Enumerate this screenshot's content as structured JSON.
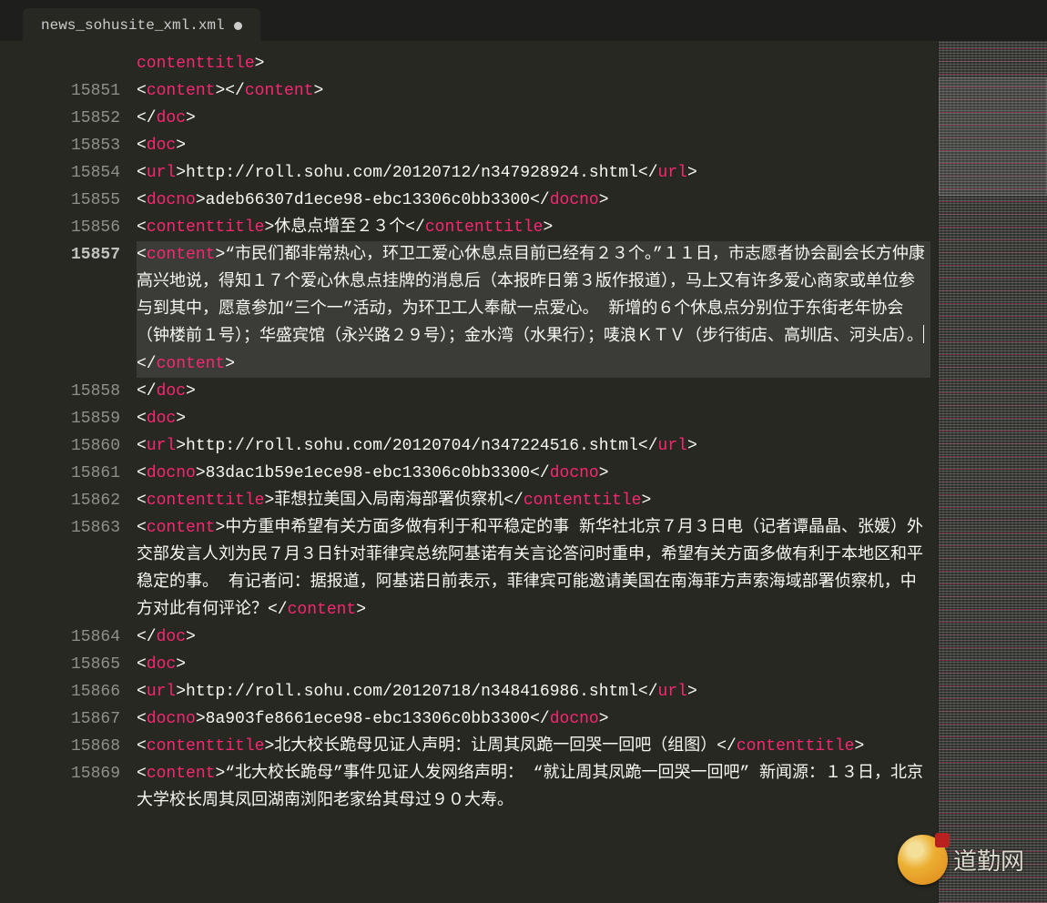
{
  "tab": {
    "filename": "news_sohusite_xml.xml",
    "dirty": true
  },
  "watermark": {
    "text": "道勤网"
  },
  "lines": [
    {
      "num": "",
      "frags": [
        [
          "tag",
          "contenttitle"
        ],
        [
          "ang",
          ">"
        ]
      ]
    },
    {
      "num": "15851",
      "frags": [
        [
          "ang",
          "<"
        ],
        [
          "tag",
          "content"
        ],
        [
          "ang",
          "></"
        ],
        [
          "tag",
          "content"
        ],
        [
          "ang",
          ">"
        ]
      ]
    },
    {
      "num": "15852",
      "frags": [
        [
          "ang",
          "</"
        ],
        [
          "tag",
          "doc"
        ],
        [
          "ang",
          ">"
        ]
      ]
    },
    {
      "num": "15853",
      "frags": [
        [
          "ang",
          "<"
        ],
        [
          "tag",
          "doc"
        ],
        [
          "ang",
          ">"
        ]
      ]
    },
    {
      "num": "15854",
      "frags": [
        [
          "ang",
          "<"
        ],
        [
          "tag",
          "url"
        ],
        [
          "ang",
          ">"
        ],
        [
          "txt",
          "http://roll.sohu.com/20120712/n347928924.shtml"
        ],
        [
          "ang",
          "</"
        ],
        [
          "tag",
          "url"
        ],
        [
          "ang",
          ">"
        ]
      ]
    },
    {
      "num": "15855",
      "frags": [
        [
          "ang",
          "<"
        ],
        [
          "tag",
          "docno"
        ],
        [
          "ang",
          ">"
        ],
        [
          "txt",
          "adeb66307d1ece98-ebc13306c0bb3300"
        ],
        [
          "ang",
          "</"
        ],
        [
          "tag",
          "docno"
        ],
        [
          "ang",
          ">"
        ]
      ]
    },
    {
      "num": "15856",
      "frags": [
        [
          "ang",
          "<"
        ],
        [
          "tag",
          "contenttitle"
        ],
        [
          "ang",
          ">"
        ],
        [
          "txt",
          "休息点增至２３个"
        ],
        [
          "ang",
          "</"
        ],
        [
          "tag",
          "contenttitle"
        ],
        [
          "ang",
          ">"
        ]
      ]
    },
    {
      "num": "15857",
      "selected": true,
      "frags": [
        [
          "ang",
          "<"
        ],
        [
          "tag",
          "content"
        ],
        [
          "ang",
          ">"
        ],
        [
          "txt",
          "“市民们都非常热心，环卫工爱心休息点目前已经有２３个。”１１日，市志愿者协会副会长方仲康高兴地说，得知１７个爱心休息点挂牌的消息后（本报昨日第３版作报道），马上又有许多爱心商家或单位参与到其中，愿意参加“三个一”活动，为环卫工人奉献一点爱心。 新增的６个休息点分别位于东街老年协会（钟楼前１号）；华盛宾馆（永兴路２９号）；金水湾（水果行）；唛浪ＫＴＶ（步行街店、高圳店、河头店）。"
        ],
        [
          "cursor",
          ""
        ],
        [
          "ang",
          "</"
        ],
        [
          "tag",
          "content"
        ],
        [
          "ang",
          ">"
        ]
      ]
    },
    {
      "num": "15858",
      "frags": [
        [
          "ang",
          "</"
        ],
        [
          "tag",
          "doc"
        ],
        [
          "ang",
          ">"
        ]
      ]
    },
    {
      "num": "15859",
      "frags": [
        [
          "ang",
          "<"
        ],
        [
          "tag",
          "doc"
        ],
        [
          "ang",
          ">"
        ]
      ]
    },
    {
      "num": "15860",
      "frags": [
        [
          "ang",
          "<"
        ],
        [
          "tag",
          "url"
        ],
        [
          "ang",
          ">"
        ],
        [
          "txt",
          "http://roll.sohu.com/20120704/n347224516.shtml"
        ],
        [
          "ang",
          "</"
        ],
        [
          "tag",
          "url"
        ],
        [
          "ang",
          ">"
        ]
      ]
    },
    {
      "num": "15861",
      "frags": [
        [
          "ang",
          "<"
        ],
        [
          "tag",
          "docno"
        ],
        [
          "ang",
          ">"
        ],
        [
          "txt",
          "83dac1b59e1ece98-ebc13306c0bb3300"
        ],
        [
          "ang",
          "</"
        ],
        [
          "tag",
          "docno"
        ],
        [
          "ang",
          ">"
        ]
      ]
    },
    {
      "num": "15862",
      "frags": [
        [
          "ang",
          "<"
        ],
        [
          "tag",
          "contenttitle"
        ],
        [
          "ang",
          ">"
        ],
        [
          "txt",
          "菲想拉美国入局南海部署侦察机"
        ],
        [
          "ang",
          "</"
        ],
        [
          "tag",
          "contenttitle"
        ],
        [
          "ang",
          ">"
        ]
      ]
    },
    {
      "num": "15863",
      "frags": [
        [
          "ang",
          "<"
        ],
        [
          "tag",
          "content"
        ],
        [
          "ang",
          ">"
        ],
        [
          "txt",
          "中方重申希望有关方面多做有利于和平稳定的事 新华社北京７月３日电（记者谭晶晶、张媛）外交部发言人刘为民７月３日针对菲律宾总统阿基诺有关言论答问时重申，希望有关方面多做有利于本地区和平稳定的事。 有记者问：据报道，阿基诺日前表示，菲律宾可能邀请美国在南海菲方声索海域部署侦察机，中方对此有何评论？"
        ],
        [
          "ang",
          "</"
        ],
        [
          "tag",
          "content"
        ],
        [
          "ang",
          ">"
        ]
      ]
    },
    {
      "num": "15864",
      "frags": [
        [
          "ang",
          "</"
        ],
        [
          "tag",
          "doc"
        ],
        [
          "ang",
          ">"
        ]
      ]
    },
    {
      "num": "15865",
      "frags": [
        [
          "ang",
          "<"
        ],
        [
          "tag",
          "doc"
        ],
        [
          "ang",
          ">"
        ]
      ]
    },
    {
      "num": "15866",
      "frags": [
        [
          "ang",
          "<"
        ],
        [
          "tag",
          "url"
        ],
        [
          "ang",
          ">"
        ],
        [
          "txt",
          "http://roll.sohu.com/20120718/n348416986.shtml"
        ],
        [
          "ang",
          "</"
        ],
        [
          "tag",
          "url"
        ],
        [
          "ang",
          ">"
        ]
      ]
    },
    {
      "num": "15867",
      "frags": [
        [
          "ang",
          "<"
        ],
        [
          "tag",
          "docno"
        ],
        [
          "ang",
          ">"
        ],
        [
          "txt",
          "8a903fe8661ece98-ebc13306c0bb3300"
        ],
        [
          "ang",
          "</"
        ],
        [
          "tag",
          "docno"
        ],
        [
          "ang",
          ">"
        ]
      ]
    },
    {
      "num": "15868",
      "frags": [
        [
          "ang",
          "<"
        ],
        [
          "tag",
          "contenttitle"
        ],
        [
          "ang",
          ">"
        ],
        [
          "txt",
          "北大校长跪母见证人声明：让周其凤跪一回哭一回吧（组图）"
        ],
        [
          "ang",
          "</"
        ],
        [
          "tag",
          "contenttitle"
        ],
        [
          "ang",
          ">"
        ]
      ]
    },
    {
      "num": "15869",
      "frags": [
        [
          "ang",
          "<"
        ],
        [
          "tag",
          "content"
        ],
        [
          "ang",
          ">"
        ],
        [
          "txt",
          "“北大校长跪母”事件见证人发网络声明： “就让周其凤跪一回哭一回吧” 新闻源：１３日，北京大学校长周其凤回湖南浏阳老家给其母过９０大寿。"
        ]
      ]
    }
  ]
}
